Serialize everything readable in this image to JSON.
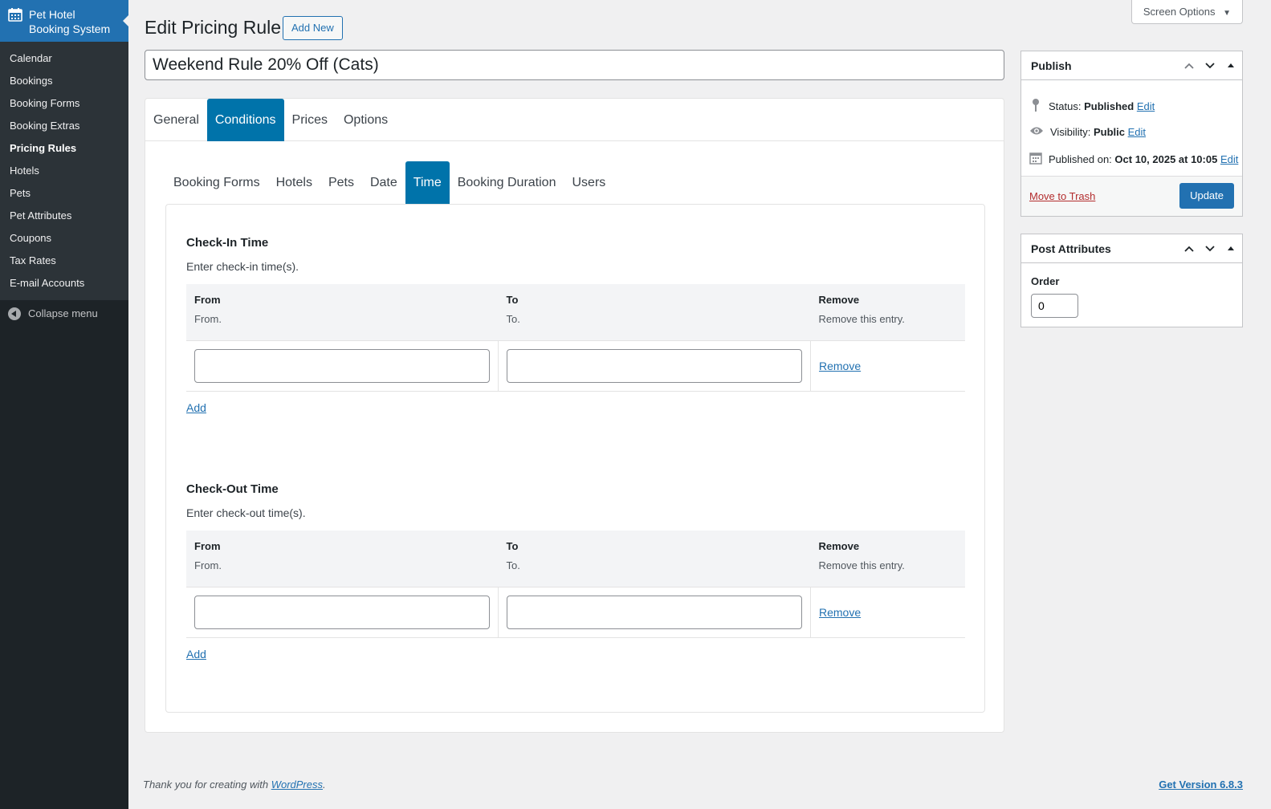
{
  "sidebar": {
    "brand_line1": "Pet Hotel",
    "brand_line2": "Booking System",
    "items": [
      {
        "label": "Calendar"
      },
      {
        "label": "Bookings"
      },
      {
        "label": "Booking Forms"
      },
      {
        "label": "Booking Extras"
      },
      {
        "label": "Pricing Rules"
      },
      {
        "label": "Hotels"
      },
      {
        "label": "Pets"
      },
      {
        "label": "Pet Attributes"
      },
      {
        "label": "Coupons"
      },
      {
        "label": "Tax Rates"
      },
      {
        "label": "E-mail Accounts"
      }
    ],
    "current": "Pricing Rules",
    "collapse_label": "Collapse menu"
  },
  "header": {
    "screen_options": "Screen Options",
    "title": "Edit Pricing Rule",
    "add_new": "Add New"
  },
  "post": {
    "title": "Weekend Rule 20% Off (Cats)"
  },
  "tabs": {
    "main": [
      "General",
      "Conditions",
      "Prices",
      "Options"
    ],
    "main_active": "Conditions",
    "sub": [
      "Booking Forms",
      "Hotels",
      "Pets",
      "Date",
      "Time",
      "Booking Duration",
      "Users"
    ],
    "sub_active": "Time"
  },
  "checkin": {
    "title": "Check-In Time",
    "desc": "Enter check-in time(s).",
    "headers": {
      "from": "From",
      "from_sub": "From.",
      "to": "To",
      "to_sub": "To.",
      "remove": "Remove",
      "remove_sub": "Remove this entry."
    },
    "row": {
      "from": "",
      "to": "",
      "remove": "Remove"
    },
    "add": "Add"
  },
  "checkout": {
    "title": "Check-Out Time",
    "desc": "Enter check-out time(s).",
    "headers": {
      "from": "From",
      "from_sub": "From.",
      "to": "To",
      "to_sub": "To.",
      "remove": "Remove",
      "remove_sub": "Remove this entry."
    },
    "row": {
      "from": "",
      "to": "",
      "remove": "Remove"
    },
    "add": "Add"
  },
  "publish": {
    "title": "Publish",
    "status_label": "Status:",
    "status_value": "Published",
    "visibility_label": "Visibility:",
    "visibility_value": "Public",
    "published_label": "Published on:",
    "published_value": "Oct 10, 2025 at 10:05",
    "edit": "Edit",
    "trash": "Move to Trash",
    "update": "Update"
  },
  "attributes": {
    "title": "Post Attributes",
    "order_label": "Order",
    "order_value": "0"
  },
  "footer": {
    "thanks": "Thank you for creating with ",
    "wp": "WordPress",
    "dot": ".",
    "version": "Get Version 6.8.3"
  },
  "colors": {
    "accent": "#2271b1",
    "tab_active": "#0073aa",
    "sidebar_bg": "#1d2327",
    "trash": "#b32d2e"
  }
}
